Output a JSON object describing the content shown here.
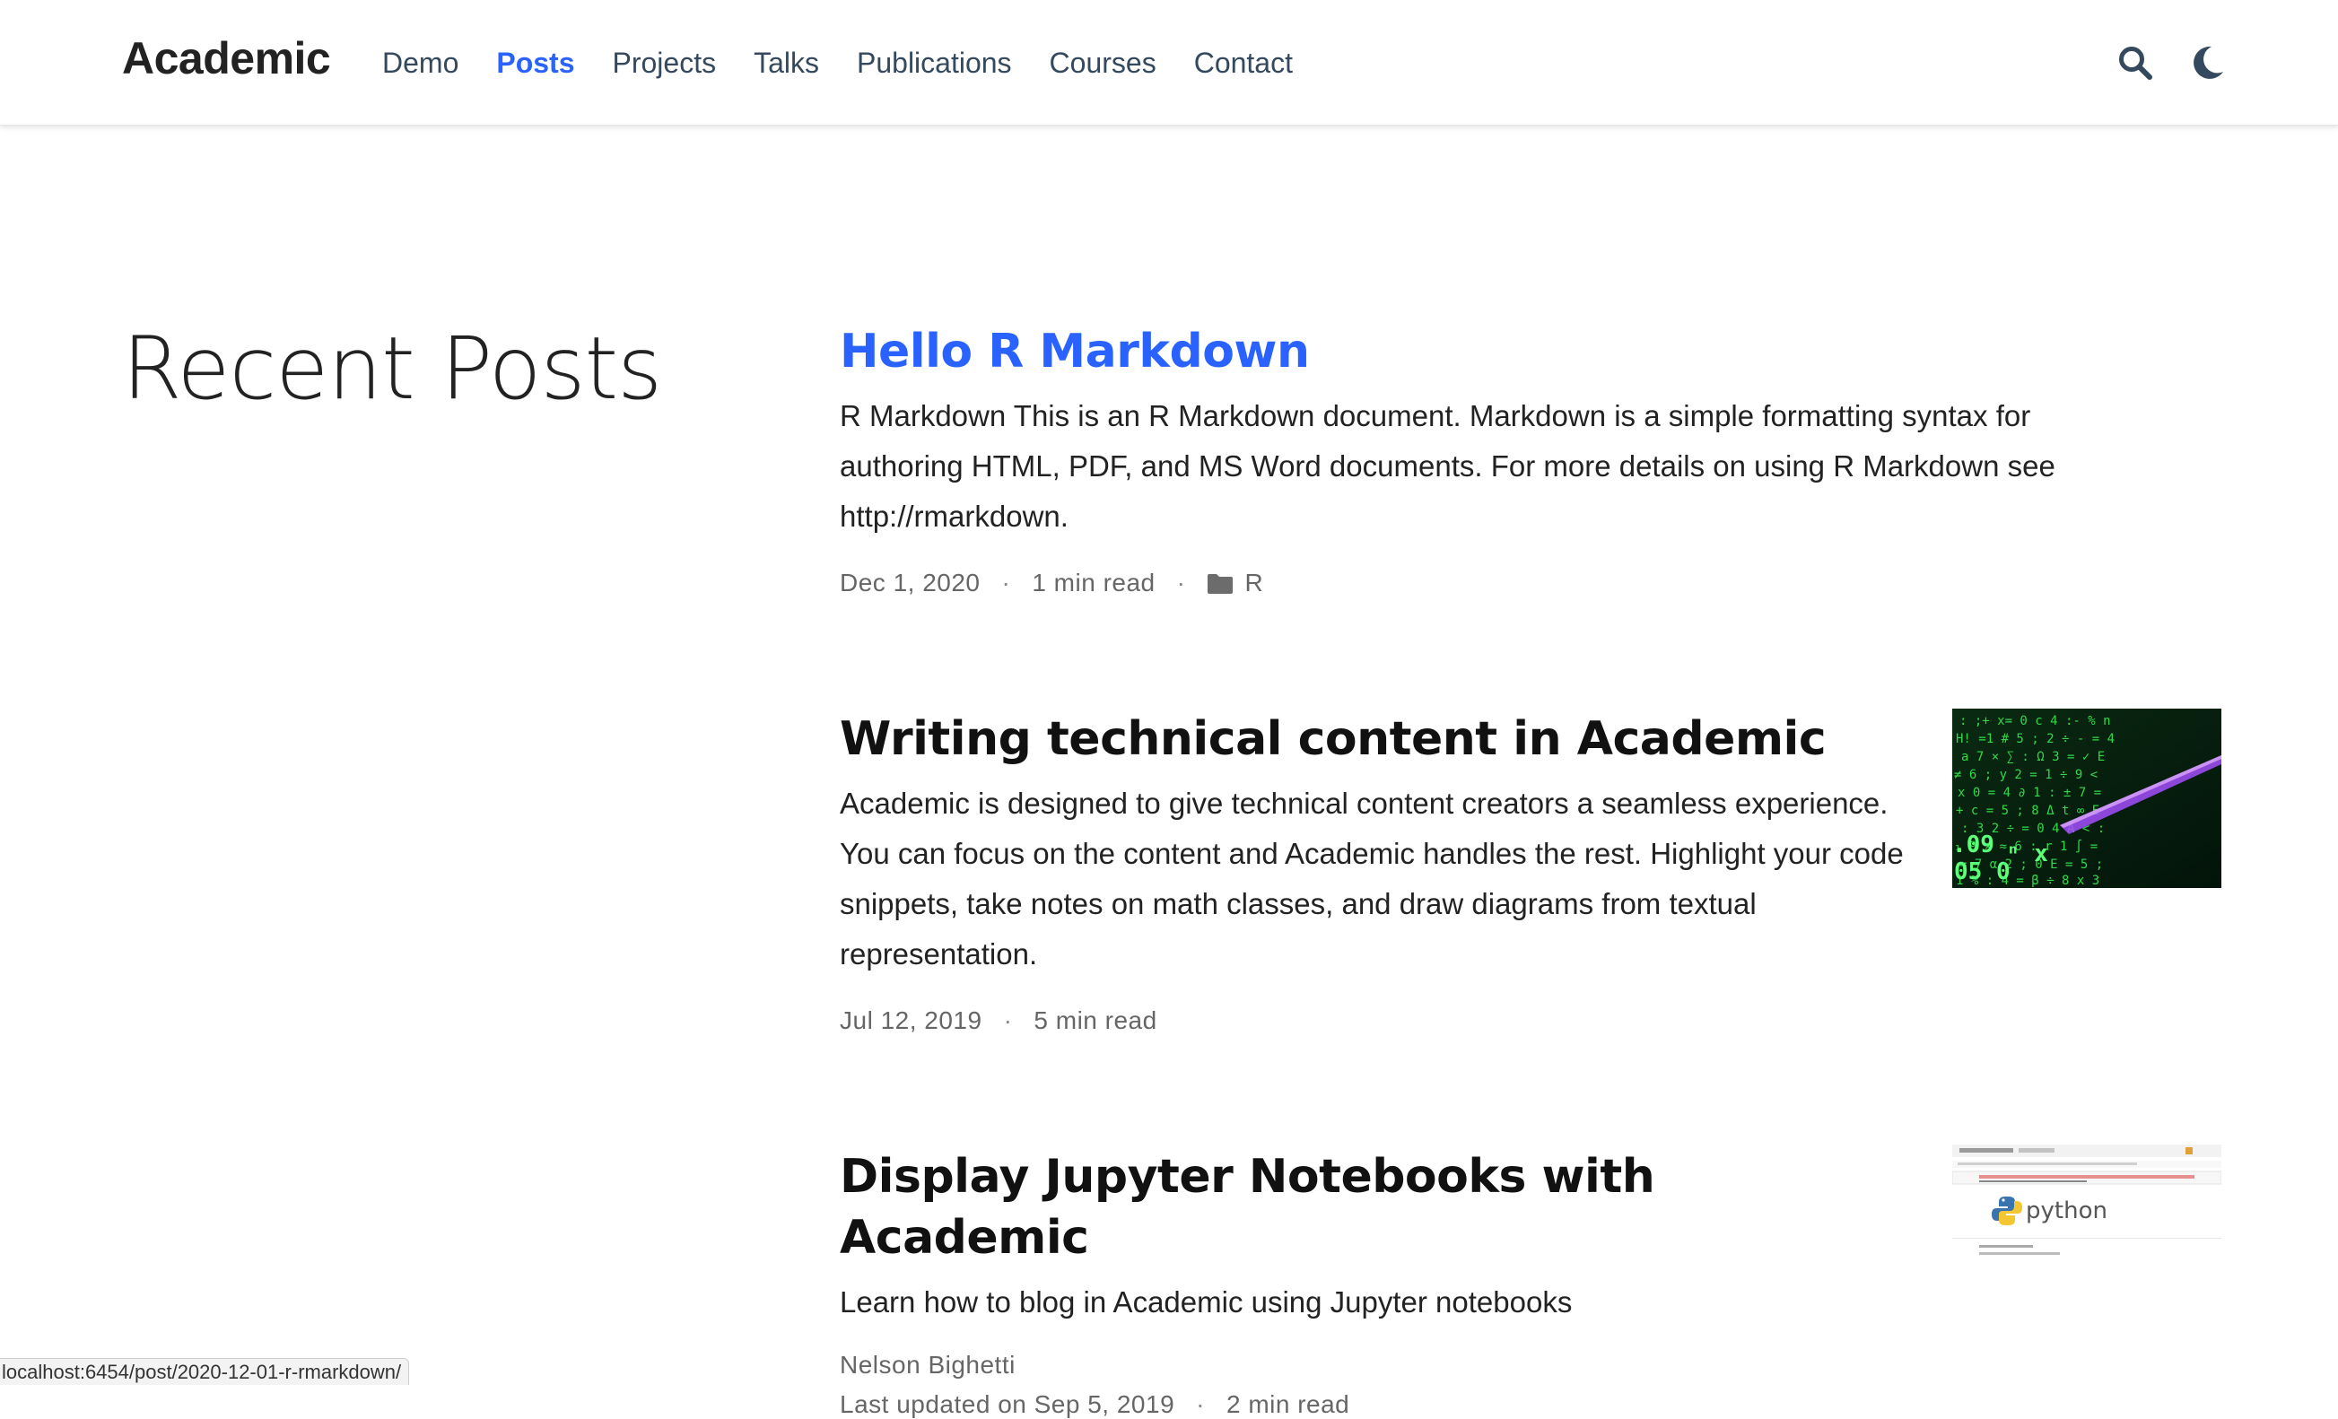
{
  "navbar": {
    "brand": "Academic",
    "links": [
      {
        "label": "Demo",
        "active": false
      },
      {
        "label": "Posts",
        "active": true
      },
      {
        "label": "Projects",
        "active": false
      },
      {
        "label": "Talks",
        "active": false
      },
      {
        "label": "Publications",
        "active": false
      },
      {
        "label": "Courses",
        "active": false
      },
      {
        "label": "Contact",
        "active": false
      }
    ],
    "icons": {
      "search": "search-icon",
      "theme": "moon-icon"
    },
    "accent_color": "#2962ff"
  },
  "page": {
    "heading": "Recent Posts"
  },
  "posts": [
    {
      "title": "Hello R Markdown",
      "summary": "R Markdown This is an R Markdown document. Markdown is a simple formatting syntax for authoring HTML, PDF, and MS Word documents. For more details on using R Markdown see http://rmarkdown.",
      "date": "Dec 1, 2020",
      "read_time": "1 min read",
      "category": "R",
      "separator": "·"
    },
    {
      "title": "Writing technical content in Academic",
      "summary": "Academic is designed to give technical content creators a seamless experience. You can focus on the content and Academic handles the rest. Highlight your code snippets, take notes on math classes, and draw diagrams from textual representation.",
      "date": "Jul 12, 2019",
      "read_time": "5 min read",
      "separator": "·",
      "thumbnail": "green-code-matrix-image"
    },
    {
      "title": "Display Jupyter Notebooks with Academic",
      "summary": "Learn how to blog in Academic using Jupyter notebooks",
      "author": "Nelson Bighetti",
      "updated": "Last updated on Sep 5, 2019",
      "read_time": "2 min read",
      "separator": "·",
      "thumbnail": "jupyter-python-screenshot",
      "thumbnail_text": "python"
    }
  ],
  "status_bar": {
    "url": "localhost:6454/post/2020-12-01-r-rmarkdown/"
  }
}
